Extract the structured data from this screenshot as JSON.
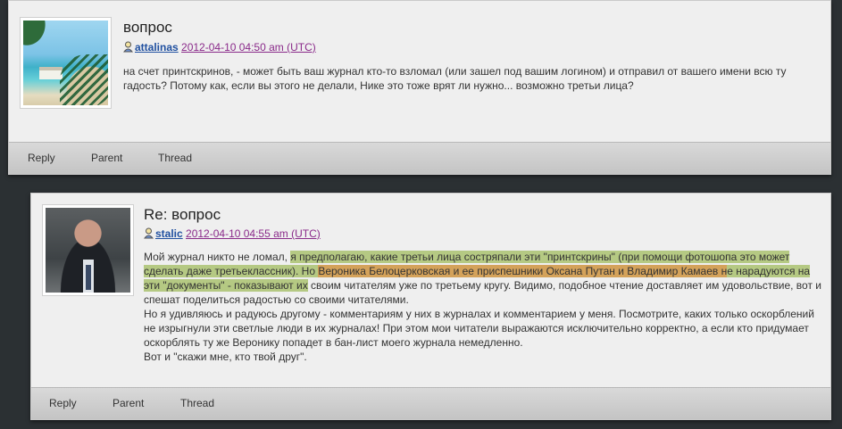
{
  "comments": [
    {
      "title": "вопрос",
      "username": "attalinas",
      "timestamp": "2012-04-10 04:50 am (UTC)",
      "body": "на счет принтскринов, - может быть ваш журнал кто-то взломал (или зашел под вашим логином) и отправил от вашего имени всю ту гадость? Потому как, если вы этого не делали, Нике это тоже врят ли нужно... возможно третьи лица?",
      "actions": {
        "reply": "Reply",
        "parent": "Parent",
        "thread": "Thread"
      }
    },
    {
      "title": "Re: вопрос",
      "username": "stalic",
      "timestamp": "2012-04-10 04:55 am (UTC)",
      "body_parts": {
        "p1": "Мой журнал никто не ломал, ",
        "p2": "я предполагаю, какие третьи лица состряпали эти \"принтскрины\" (при помощи фотошопа это может сделать даже третьеклассник). Но ",
        "p3": "Вероника Белоцерковская и ее приспешники Оксана Путан и Владимир Камаев н",
        "p4": "е нарадуются на эти \"документы\" - показывают их",
        "p5": " своим читателям уже по третьему кругу. Видимо, подобное чтение доставляет им удовольствие, вот и спешат поделиться радостью со своими читателями.",
        "p6": "Но я удивляюсь и радуюсь другому - комментариям у них в журналах и комментарием у меня. Посмотрите, каких только оскорблений не изрыгнули эти светлые люди в их журналах! При этом мои читатели выражаются исключительно корректно, а если кто придумает оскорблять ту же Веронику попадет в бан-лист моего журнала немедленно.",
        "p7": "Вот и \"скажи мне, кто твой друг\"."
      },
      "actions": {
        "reply": "Reply",
        "parent": "Parent",
        "thread": "Thread"
      }
    }
  ],
  "colors": {
    "background": "#2b3033",
    "highlight_green": "#b5c983",
    "highlight_orange": "#d4a25a",
    "user_link": "#2050a0",
    "date_link": "#8a2a8a"
  }
}
